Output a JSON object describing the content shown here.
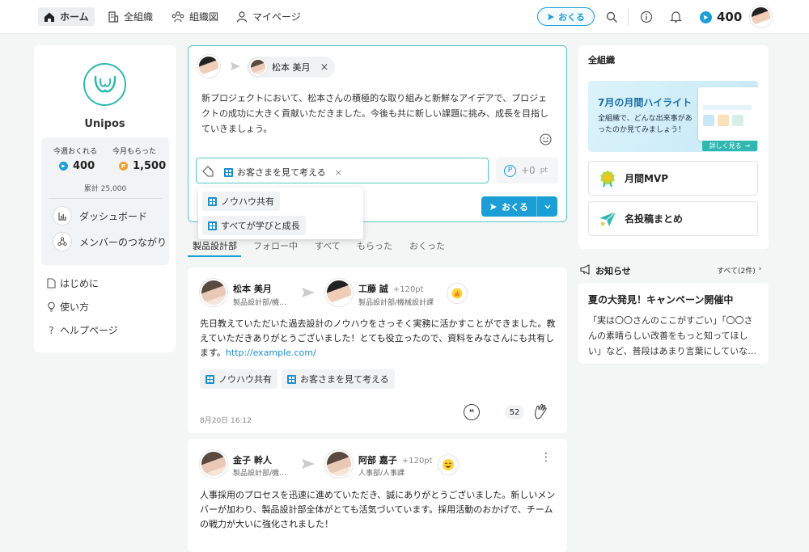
{
  "header": {
    "nav": [
      {
        "label": "ホーム",
        "icon": "home-icon"
      },
      {
        "label": "全組織",
        "icon": "building-icon"
      },
      {
        "label": "組織図",
        "icon": "org-chart-icon"
      },
      {
        "label": "マイページ",
        "icon": "user-icon"
      }
    ],
    "send_label": "おくる",
    "points": "400"
  },
  "sidebar": {
    "brand": "Unipos",
    "weekly_label": "今週おくれる",
    "weekly_value": "400",
    "received_label": "今月もらった",
    "received_value": "1,500",
    "total": "累計 25,000",
    "menu": [
      "ダッシュボード",
      "メンバーのつながり"
    ],
    "links": [
      "はじめに",
      "使い方",
      "ヘルプページ"
    ]
  },
  "composer": {
    "recipient": "松本 美月",
    "message": "新プロジェクトにおいて、松本さんの積極的な取り組みと新鮮なアイデアで、プロジェクトの成功に大きく貢献いただきました。今後も共に新しい課題に挑み、成長を目指していきましょう。",
    "selected_tag": "お客さまを見て考える",
    "points_value": "+0",
    "points_unit": "pt",
    "suggestions": [
      "ノウハウ共有",
      "すべてが学びと成長"
    ],
    "send_label": "おくる"
  },
  "tabs": [
    "製品設計部",
    "フォロー中",
    "すべて",
    "もらった",
    "おくった"
  ],
  "posts": [
    {
      "sender": "松本 美月",
      "sender_dept": "製品設計部/機…",
      "receiver": "工藤 誠",
      "points": "+120pt",
      "receiver_dept": "製品設計部/機械設計課",
      "body": "先日教えていただいた過去設計のノウハウをさっそく実務に活かすことができました。教えていただきありがとうございました！とても役立ったので、資料をみなさんにも共有します。",
      "link": "http://example.com/",
      "tags": [
        "ノウハウ共有",
        "お客さまを見て考える"
      ],
      "date": "8月20日 16:12",
      "claps": "52"
    },
    {
      "sender": "金子 幹人",
      "sender_dept": "製品設計部/機…",
      "receiver": "阿部 嘉子",
      "points": "+120pt",
      "receiver_dept": "人事部/人事課",
      "body": "人事採用のプロセスを迅速に進めていただき、誠にありがとうございました。新しいメンバーが加わり、製品設計部全体がとても活気づいています。採用活動のおかげで、チームの戦力が大いに強化されました！"
    }
  ],
  "right": {
    "org_title": "全組織",
    "banner_title": "7月の月間ハイライト",
    "banner_text": "全組織で、どんな出来事があったのか見てみましょう！",
    "banner_button": "詳しく見る",
    "mvp": "月間MVP",
    "summary": "名投稿まとめ",
    "news_title": "お知らせ",
    "news_all": "すべて(2件)",
    "news_headline": "夏の大発見！キャンペーン開催中",
    "news_body": "「実は〇〇さんのここがすごい」「〇〇さんの素晴らしい改善をもっと知ってほしい」など、普段はあまり言葉にしていな…"
  },
  "colors": {
    "accent": "#1b9ed6",
    "brand": "#2fb8b0",
    "coin": "#f0a030"
  }
}
